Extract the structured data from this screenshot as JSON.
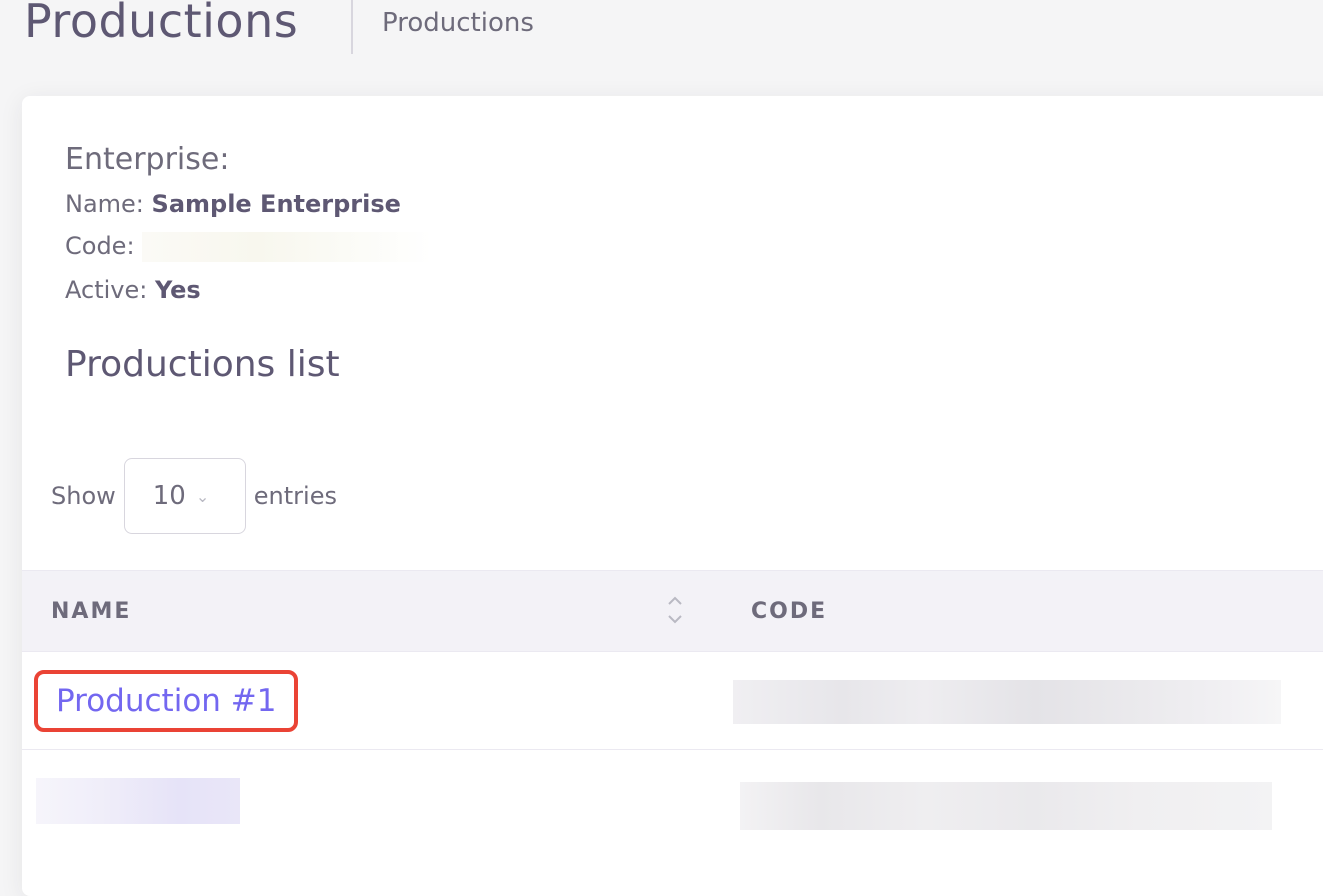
{
  "header": {
    "title": "Productions",
    "breadcrumb": "Productions"
  },
  "enterprise": {
    "heading": "Enterprise:",
    "name_label": "Name:",
    "name_value": "Sample Enterprise",
    "code_label": "Code:",
    "active_label": "Active:",
    "active_value": "Yes"
  },
  "productions_list": {
    "title": "Productions list",
    "show_label": "Show",
    "page_size": "10",
    "entries_label": "entries",
    "columns": [
      "NAME",
      "CODE"
    ],
    "rows": [
      {
        "name": "Production #1"
      }
    ]
  },
  "colors": {
    "accent": "#7367f0",
    "highlight": "#ea4335"
  }
}
